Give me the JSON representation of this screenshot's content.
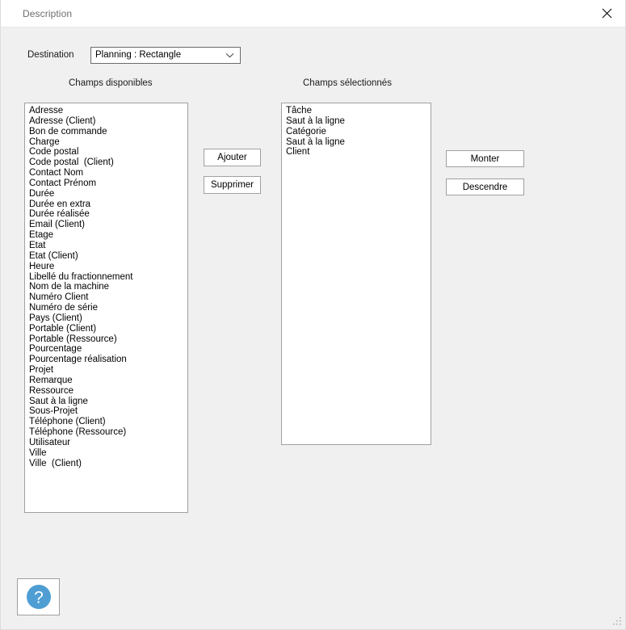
{
  "window": {
    "title": "Description",
    "close_icon": "close-icon",
    "resize_grip": "resize-grip-icon"
  },
  "destination": {
    "label": "Destination",
    "value": "Planning : Rectangle",
    "chevron_icon": "chevron-down-icon"
  },
  "columns": {
    "available_header": "Champs disponibles",
    "selected_header": "Champs sélectionnés"
  },
  "available_fields": [
    "Adresse",
    "Adresse (Client)",
    "Bon de commande",
    "Charge",
    "Code postal",
    "Code postal  (Client)",
    "Contact Nom",
    "Contact Prénom",
    "Durée",
    "Durée en extra",
    "Durée réalisée",
    "Email (Client)",
    "Etage",
    "Etat",
    "Etat (Client)",
    "Heure",
    "Libellé du fractionnement",
    "Nom de la machine",
    "Numéro Client",
    "Numéro de série",
    "Pays (Client)",
    "Portable (Client)",
    "Portable (Ressource)",
    "Pourcentage",
    "Pourcentage réalisation",
    "Projet",
    "Remarque",
    "Ressource",
    "Saut à la ligne",
    "Sous-Projet",
    "Téléphone (Client)",
    "Téléphone (Ressource)",
    "Utilisateur",
    "Ville",
    "Ville  (Client)"
  ],
  "selected_fields": [
    "Tâche",
    "Saut à la ligne",
    "Catégorie",
    "Saut à la ligne",
    "Client"
  ],
  "buttons": {
    "add": "Ajouter",
    "remove": "Supprimer",
    "move_up": "Monter",
    "move_down": "Descendre"
  },
  "help": {
    "icon": "help-question-icon",
    "glyph": "?",
    "color": "#4e9ed4"
  }
}
